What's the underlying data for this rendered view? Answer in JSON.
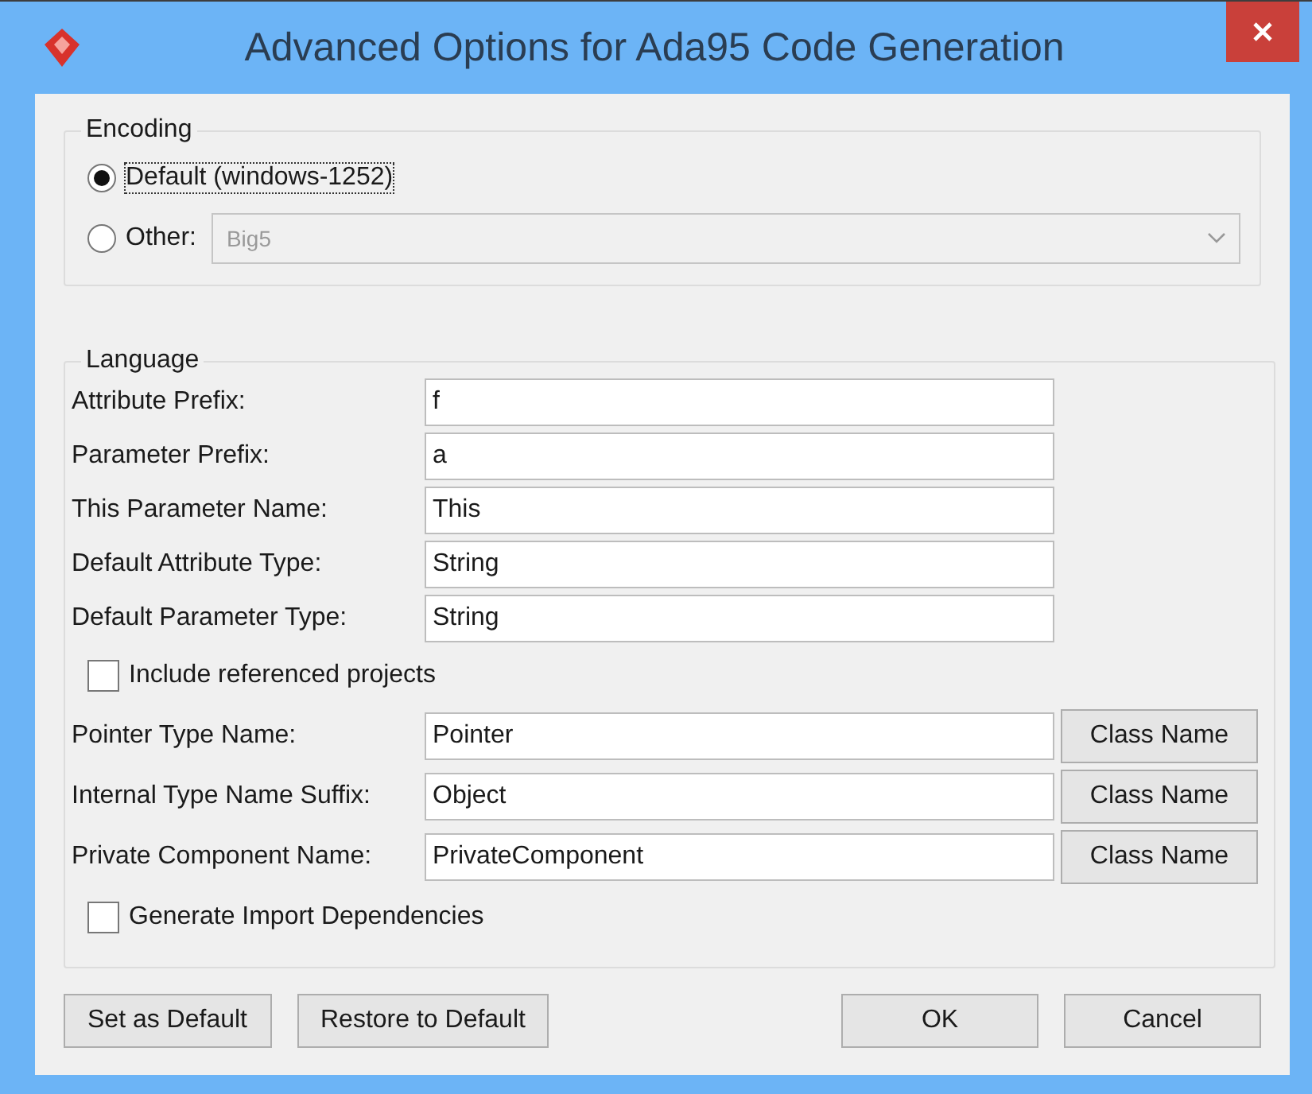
{
  "window": {
    "title": "Advanced Options for Ada95 Code Generation"
  },
  "encoding": {
    "title": "Encoding",
    "options": [
      {
        "kind": "plain",
        "label": "Default (windows-1252)",
        "selected": true
      },
      {
        "kind": "dropdown",
        "label": "Other:",
        "selected": false,
        "value": "Big5",
        "disabled": true
      }
    ]
  },
  "language": {
    "title": "Language",
    "fields": [
      {
        "label": "Attribute Prefix:",
        "value": "f"
      },
      {
        "label": "Parameter Prefix:",
        "value": "a"
      },
      {
        "label": "This Parameter Name:",
        "value": "This"
      },
      {
        "label": "Default Attribute Type:",
        "value": "String"
      },
      {
        "label": "Default Parameter Type:",
        "value": "String"
      }
    ],
    "include_referenced": {
      "label": "Include referenced projects",
      "checked": false
    },
    "type_fields": [
      {
        "label": "Pointer Type Name:",
        "value": "Pointer",
        "button": "Class Name"
      },
      {
        "label": "Internal Type Name Suffix:",
        "value": "Object",
        "button": "Class Name"
      },
      {
        "label": "Private Component Name:",
        "value": "PrivateComponent",
        "button": "Class Name"
      }
    ],
    "generate_import": {
      "label": "Generate Import Dependencies",
      "checked": false
    }
  },
  "buttons_left": [
    "Set as Default",
    "Restore to Default"
  ],
  "buttons_right": [
    "OK",
    "Cancel"
  ]
}
